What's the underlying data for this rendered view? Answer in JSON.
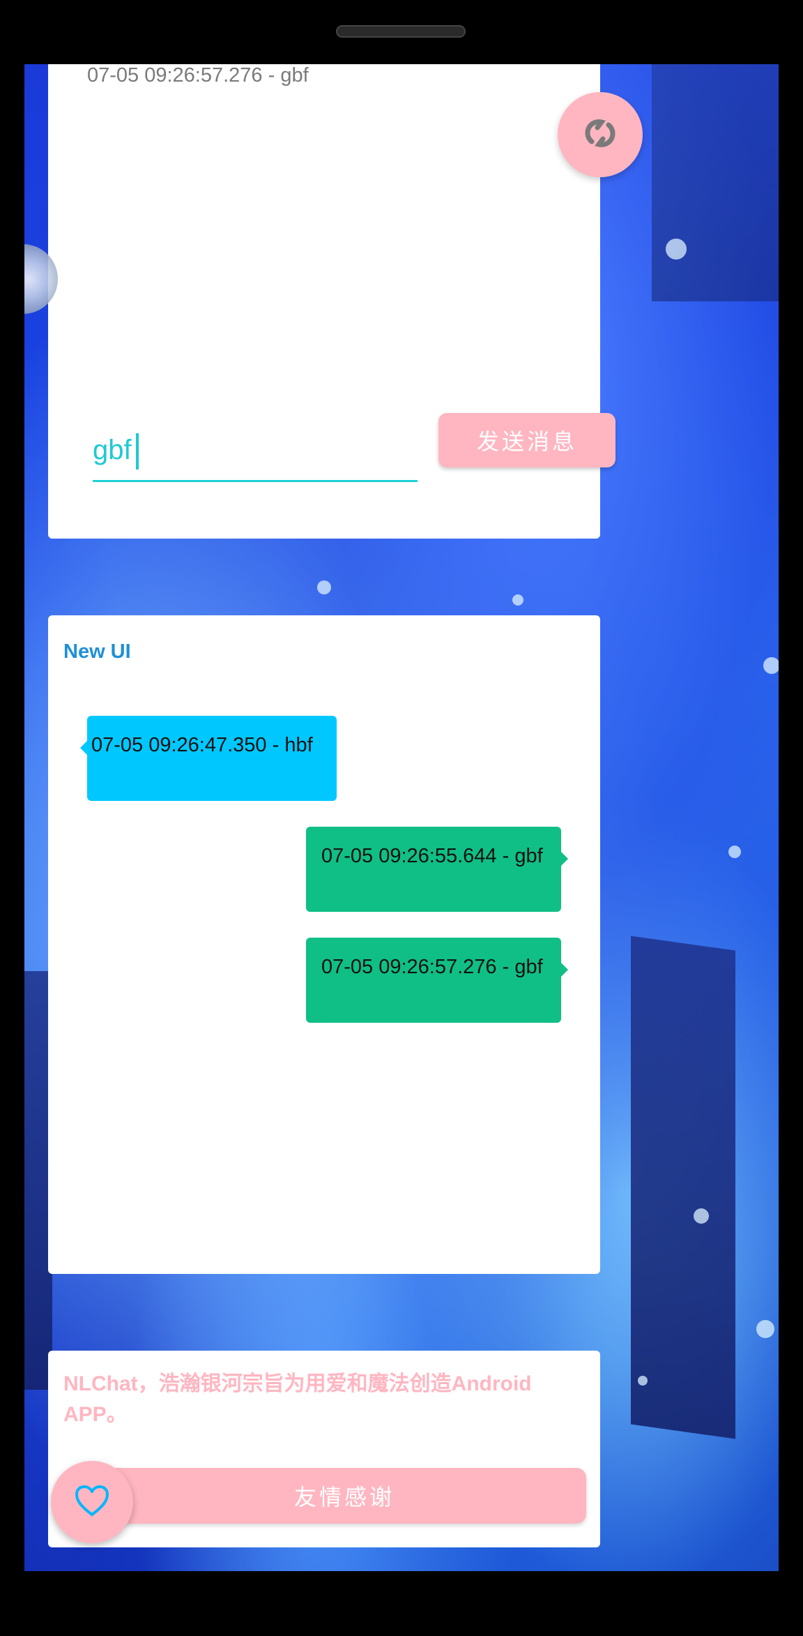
{
  "top_panel": {
    "last_log": "07-05 09:26:57.276 - gbf",
    "input_value": "gbf",
    "send_label": "发送消息"
  },
  "chat_panel": {
    "title": "New UI",
    "messages": [
      {
        "side": "left",
        "text": "07-05 09:26:47.350 - hbf"
      },
      {
        "side": "right",
        "text": "07-05 09:26:55.644 - gbf"
      },
      {
        "side": "right",
        "text": "07-05 09:26:57.276 - gbf"
      }
    ]
  },
  "about_panel": {
    "text": "NLChat，浩瀚银河宗旨为用爱和魔法创造Android APP。",
    "thanks_label": "友情感谢"
  },
  "icons": {
    "sync": "sync-icon",
    "heart": "heart-icon",
    "avatar": "avatar"
  },
  "colors": {
    "accent_pink": "#ffb6c1",
    "accent_cyan": "#1fc9d4",
    "title_blue": "#1e90d6",
    "bubble_left": "#00c8ff",
    "bubble_right": "#10bf85"
  }
}
